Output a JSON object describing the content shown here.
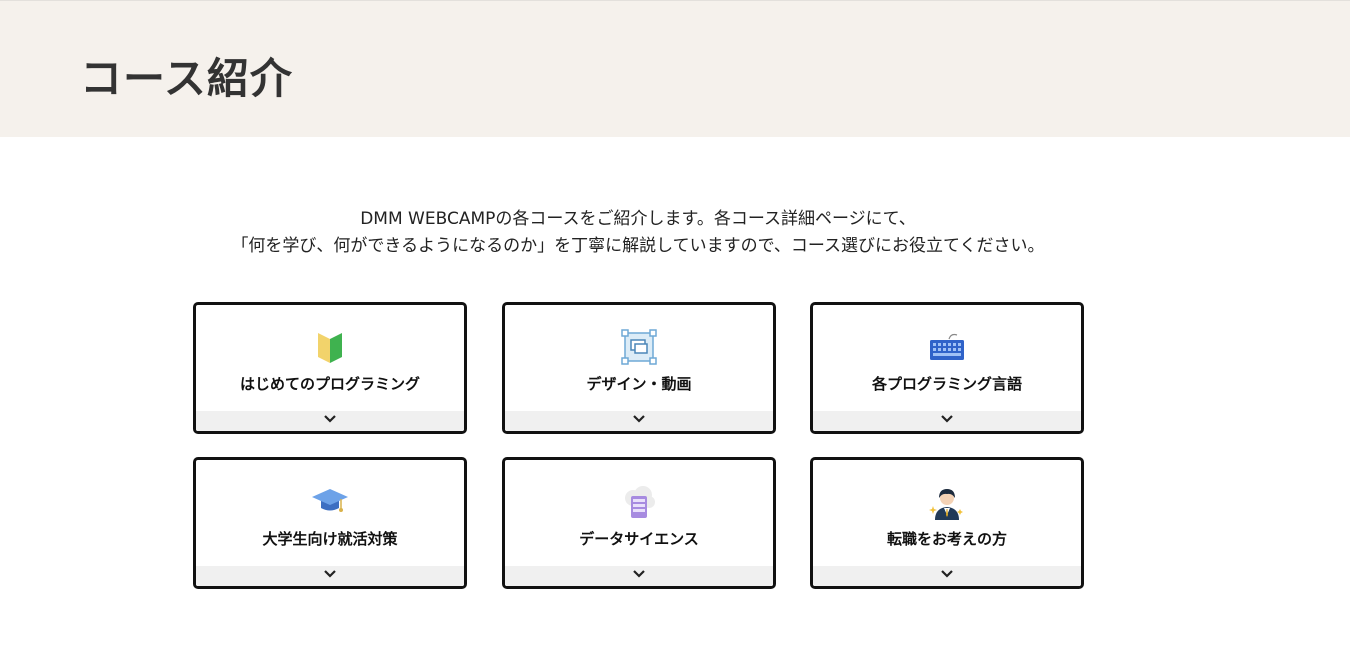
{
  "header": {
    "title": "コース紹介"
  },
  "intro": {
    "line1": "DMM WEBCAMPの各コースをご紹介します。各コース詳細ページにて、",
    "line2": "「何を学び、何ができるようになるのか」を丁寧に解説していますので、コース選びにお役立てください。"
  },
  "courses": [
    {
      "label": "はじめてのプログラミング",
      "icon": "beginner-leaf-icon"
    },
    {
      "label": "デザイン・動画",
      "icon": "design-frame-icon"
    },
    {
      "label": "各プログラミング言語",
      "icon": "keyboard-icon"
    },
    {
      "label": "大学生向け就活対策",
      "icon": "graduation-cap-icon"
    },
    {
      "label": "データサイエンス",
      "icon": "data-server-icon"
    },
    {
      "label": "転職をお考えの方",
      "icon": "businessperson-icon"
    }
  ],
  "colors": {
    "hero_background": "#f5f1ec",
    "card_border": "#111111",
    "card_footer": "#f0f0f0"
  }
}
